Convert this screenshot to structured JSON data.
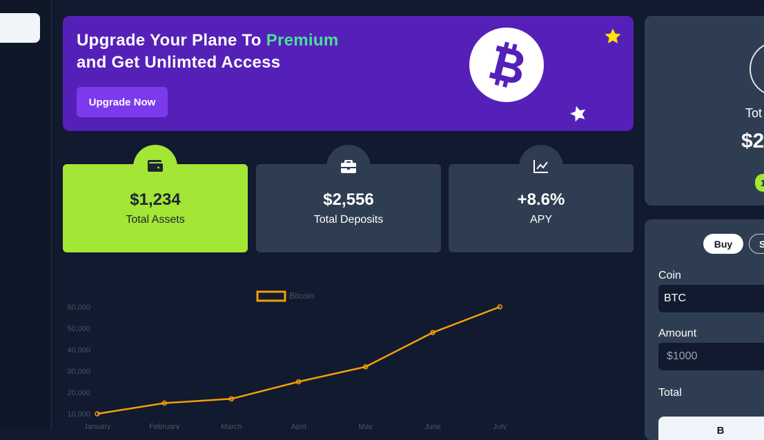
{
  "banner": {
    "title_line1_prefix": "Upgrade Your Plane To ",
    "title_highlight": "Premium",
    "title_line2": "and Get Unlimted Access",
    "button_label": "Upgrade Now",
    "coin_icon": "bitcoin-icon",
    "accent_color": "#4ade9c"
  },
  "stats": [
    {
      "value": "$1,234",
      "label": "Total Assets",
      "icon": "wallet-icon"
    },
    {
      "value": "$2,556",
      "label": "Total Deposits",
      "icon": "briefcase-icon"
    },
    {
      "value": "+8.6%",
      "label": "APY",
      "icon": "trend-chart-icon"
    }
  ],
  "chart_data": {
    "type": "line",
    "legend": "Bitcoin",
    "categories": [
      "January",
      "February",
      "March",
      "April",
      "May",
      "June",
      "July"
    ],
    "series": [
      {
        "name": "Bitcoin",
        "values": [
          10000,
          15000,
          17000,
          25000,
          32000,
          48000,
          60000
        ]
      }
    ],
    "yticks": [
      "10,000",
      "20,000",
      "30,000",
      "40,000",
      "50,000",
      "60,000"
    ],
    "ylim": [
      10000,
      60000
    ],
    "color": "#f59e0b",
    "grid": false,
    "legend_position": "top-center"
  },
  "right_panel": {
    "label": "Tot",
    "value": "$2",
    "badge": "1"
  },
  "trade": {
    "tab_buy": "Buy",
    "tab_sell": "S",
    "coin_label": "Coin",
    "coin_value": "BTC",
    "amount_label": "Amount",
    "amount_placeholder": "$1000",
    "total_label": "Total",
    "submit_label": "B"
  }
}
